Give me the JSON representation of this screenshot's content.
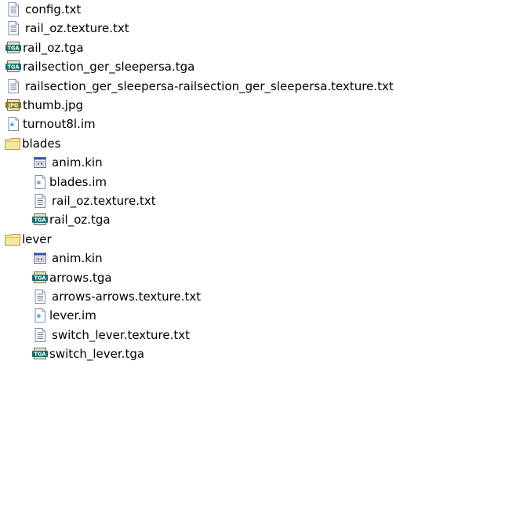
{
  "tree": {
    "items": [
      {
        "label": "config.txt",
        "icon": "text-file-icon",
        "kind": "file",
        "depth": 0
      },
      {
        "label": "rail_oz.texture.txt",
        "icon": "text-file-icon",
        "kind": "file",
        "depth": 0
      },
      {
        "label": "rail_oz.tga",
        "icon": "tga-image-icon",
        "kind": "file",
        "depth": 0
      },
      {
        "label": "railsection_ger_sleepersa.tga",
        "icon": "tga-image-icon",
        "kind": "file",
        "depth": 0
      },
      {
        "label": "railsection_ger_sleepersa-railsection_ger_sleepersa.texture.txt",
        "icon": "text-file-icon",
        "kind": "file",
        "depth": 0
      },
      {
        "label": "thumb.jpg",
        "icon": "jpg-image-icon",
        "kind": "file",
        "depth": 0
      },
      {
        "label": "turnout8l.im",
        "icon": "mesh-file-icon",
        "kind": "file",
        "depth": 0
      },
      {
        "label": "blades",
        "icon": "folder-icon",
        "kind": "folder",
        "depth": 0
      },
      {
        "label": "anim.kin",
        "icon": "animation-file-icon",
        "kind": "file",
        "depth": 1
      },
      {
        "label": "blades.im",
        "icon": "mesh-file-icon",
        "kind": "file",
        "depth": 1
      },
      {
        "label": "rail_oz.texture.txt",
        "icon": "text-file-icon",
        "kind": "file",
        "depth": 1
      },
      {
        "label": "rail_oz.tga",
        "icon": "tga-image-icon",
        "kind": "file",
        "depth": 1
      },
      {
        "label": "lever",
        "icon": "folder-icon",
        "kind": "folder",
        "depth": 0
      },
      {
        "label": "anim.kin",
        "icon": "animation-file-icon",
        "kind": "file",
        "depth": 1
      },
      {
        "label": "arrows.tga",
        "icon": "tga-image-icon",
        "kind": "file",
        "depth": 1
      },
      {
        "label": "arrows-arrows.texture.txt",
        "icon": "text-file-icon",
        "kind": "file",
        "depth": 1
      },
      {
        "label": "lever.im",
        "icon": "mesh-file-icon",
        "kind": "file",
        "depth": 1
      },
      {
        "label": "switch_lever.texture.txt",
        "icon": "text-file-icon",
        "kind": "file",
        "depth": 1
      },
      {
        "label": "switch_lever.tga",
        "icon": "tga-image-icon",
        "kind": "file",
        "depth": 1
      }
    ]
  },
  "badges": {
    "tga": "TGA",
    "jpg": "JPG"
  },
  "colors": {
    "text": "#000000",
    "background": "#ffffff",
    "folder_fill": "#f6e6a6",
    "folder_stroke": "#b79a3a",
    "tga_badge": "#1a6b6b",
    "jpg_badge": "#8a7a10",
    "page_stroke": "#7a8ca8"
  }
}
